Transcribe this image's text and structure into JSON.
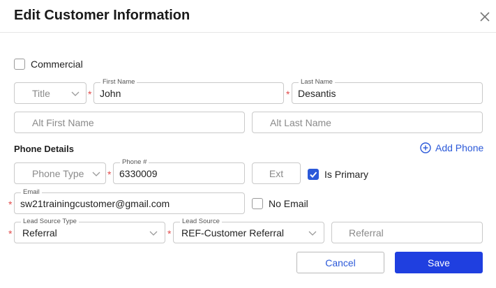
{
  "dialog": {
    "title": "Edit Customer Information",
    "close_icon": "close-icon"
  },
  "commercial": {
    "label": "Commercial",
    "checked": false
  },
  "name": {
    "title_placeholder": "Title",
    "first_name_label": "First Name",
    "first_name_value": "John",
    "last_name_label": "Last Name",
    "last_name_value": "Desantis",
    "alt_first_placeholder": "Alt First Name",
    "alt_last_placeholder": "Alt Last Name",
    "required_mark": "*"
  },
  "phone": {
    "section_title": "Phone Details",
    "add_phone_label": "Add Phone",
    "phone_type_placeholder": "Phone Type",
    "phone_label": "Phone #",
    "phone_value": "6330009",
    "ext_placeholder": "Ext",
    "is_primary_label": "Is Primary",
    "is_primary_checked": true
  },
  "email": {
    "label": "Email",
    "value": "sw21trainingcustomer@gmail.com",
    "no_email_label": "No Email",
    "no_email_checked": false
  },
  "lead": {
    "type_label": "Lead Source Type",
    "type_value": "Referral",
    "source_label": "Lead Source",
    "source_value": "REF-Customer Referral",
    "referral_placeholder": "Referral"
  },
  "buttons": {
    "cancel": "Cancel",
    "save": "Save"
  },
  "colors": {
    "accent": "#2b59d9",
    "primary_button": "#1f3fe0",
    "required": "#e14a4a"
  }
}
